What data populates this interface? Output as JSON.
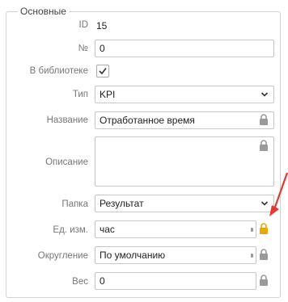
{
  "section": {
    "title": "Основные"
  },
  "fields": {
    "id": {
      "label": "ID",
      "value": "15"
    },
    "number": {
      "label": "№",
      "value": "0"
    },
    "in_library": {
      "label": "В библиотеке",
      "checked": true
    },
    "type": {
      "label": "Тип",
      "value": "KPI"
    },
    "name": {
      "label": "Название",
      "value": "Отработанное время"
    },
    "description": {
      "label": "Описание",
      "value": ""
    },
    "folder": {
      "label": "Папка",
      "value": "Результат"
    },
    "unit": {
      "label": "Ед. изм.",
      "value": "час"
    },
    "rounding": {
      "label": "Округление",
      "value": "По умолчанию"
    },
    "weight": {
      "label": "Вес",
      "value": "0"
    }
  },
  "colors": {
    "lock_default": "#9a9a9a",
    "lock_active": "#e8a800",
    "arrow": "#e03a2f"
  },
  "icons": {
    "lock": "lock-icon",
    "chevron": "chevron-down-icon",
    "check": "checkmark-icon"
  }
}
